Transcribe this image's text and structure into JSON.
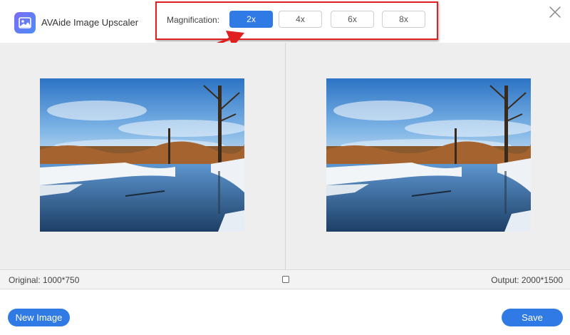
{
  "app": {
    "title": "AVAide Image Upscaler",
    "logo_icon": "image-upscale-logo-icon",
    "accent_color": "#2f7ae5"
  },
  "magnification": {
    "label": "Magnification:",
    "options": [
      "2x",
      "4x",
      "6x",
      "8x"
    ],
    "selected": "2x",
    "highlight_color": "#e02020"
  },
  "window": {
    "close_icon": "close-icon"
  },
  "preview": {
    "original_image": "winter-river-landscape",
    "output_image": "winter-river-landscape"
  },
  "status": {
    "original": "Original: 1000*750",
    "output": "Output: 2000*1500",
    "compare_icon": "compare-square-icon"
  },
  "footer": {
    "new_image_label": "New Image",
    "save_label": "Save"
  }
}
